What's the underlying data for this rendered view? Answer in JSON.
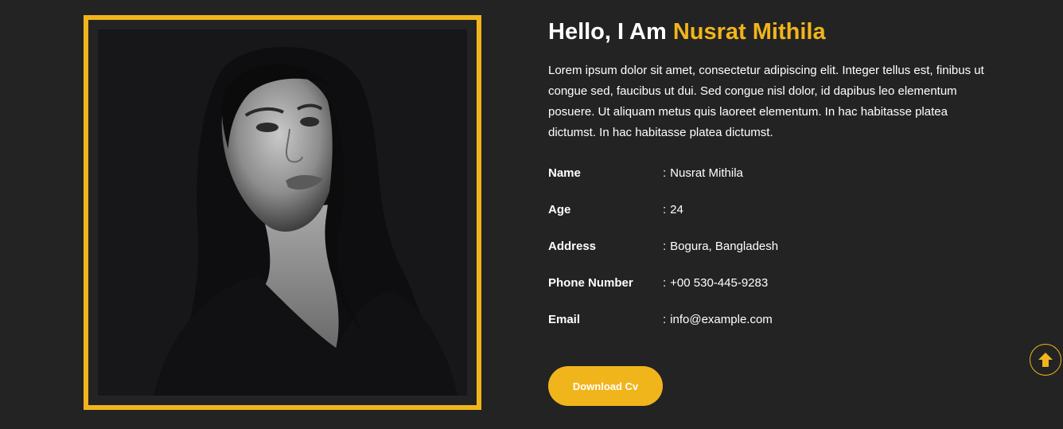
{
  "about": {
    "heading_prefix": "Hello, I Am ",
    "heading_name": "Nusrat Mithila",
    "intro": "Lorem ipsum dolor sit amet, consectetur adipiscing elit. Integer tellus est, finibus ut congue sed, faucibus ut dui. Sed congue nisl dolor, id dapibus leo elementum posuere. Ut aliquam metus quis laoreet elementum. In hac habitasse platea dictumst. In hac habitasse platea dictumst.",
    "separator": ":",
    "info": [
      {
        "label": "Name",
        "value": "Nusrat Mithila"
      },
      {
        "label": "Age",
        "value": "24"
      },
      {
        "label": "Address",
        "value": "Bogura, Bangladesh"
      },
      {
        "label": "Phone Number",
        "value": "+00 530-445-9283"
      },
      {
        "label": "Email",
        "value": "info@example.com"
      }
    ],
    "download_label": "Download Cv"
  },
  "icons": {
    "scroll_top": "arrow-up-icon"
  },
  "colors": {
    "accent": "#f1b51c",
    "background": "#232323",
    "text": "#ffffff"
  }
}
